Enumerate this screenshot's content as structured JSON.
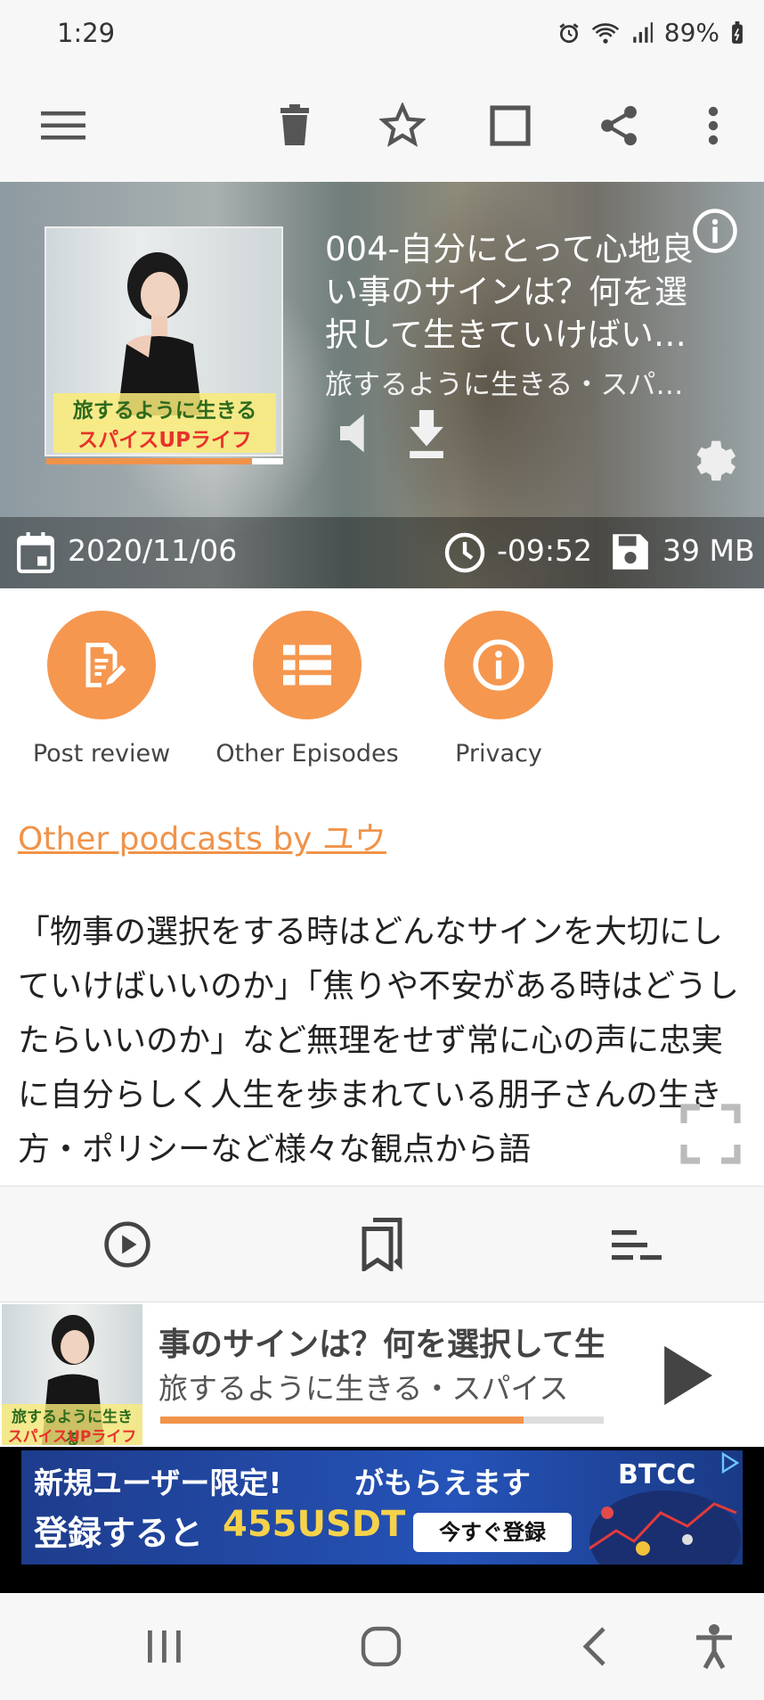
{
  "status_bar": {
    "time": "1:29",
    "battery": "89%",
    "icons": [
      "alarm-icon",
      "wifi-icon",
      "signal-icon",
      "battery-icon"
    ]
  },
  "toolbar": {
    "icons": [
      "menu-icon",
      "delete-icon",
      "star-icon",
      "checkbox-icon",
      "share-icon",
      "more-vert-icon"
    ]
  },
  "episode": {
    "title": "004-自分にとって心地良い事のサインは？何を選択して生きていけばい…",
    "podcast": "旅するように生きる・スパ…",
    "date": "2020/11/06",
    "remaining": "-09:52",
    "size": "39 MB",
    "cover_caption_1": "旅するように生きる",
    "cover_caption_2": "スパイスUPライフ",
    "cover_progress": 0.87
  },
  "actions": [
    {
      "label": "Post review",
      "icon": "edit-note-icon"
    },
    {
      "label": "Other Episodes",
      "icon": "list-icon"
    },
    {
      "label": "Privacy",
      "icon": "info-icon"
    }
  ],
  "other_podcasts_link": "Other podcasts by ユウ",
  "description": "「物事の選択をする時はどんなサインを大切にしていけばいいのか」「焦りや不安がある時はどうしたらいいのか」など無理をせず常に心の声に忠実に自分らしく人生を歩まれている朋子さんの生き方・ポリシーなど様々な観点から語",
  "bottom_tabs": [
    "play-circle-icon",
    "bookmarks-icon",
    "queue-icon"
  ],
  "mini_player": {
    "title": "事のサインは？何を選択して生",
    "subtitle": "旅するように生きる・スパイス",
    "progress": 0.82
  },
  "ad": {
    "line1": "新規ユーザー限定!",
    "line1b": "がもらえます",
    "line2a": "登録すると",
    "line2b": "455USDT",
    "button": "今すぐ登録",
    "brand": "BTCC"
  },
  "colors": {
    "accent": "#f0934a",
    "toolbar_bg": "#f7f7f7"
  }
}
